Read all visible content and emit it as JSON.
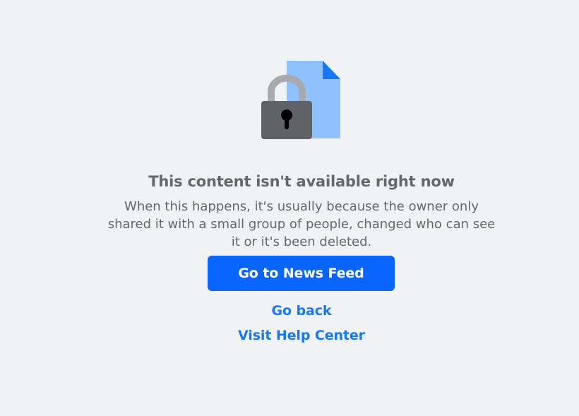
{
  "icon": {
    "name": "lock-document-icon",
    "colors": {
      "document": "#8fc1ff",
      "document_fold": "#1877f2",
      "shackle": "#a8aaaf",
      "lock_body": "#5f6368",
      "keyhole": "#000000"
    }
  },
  "message": {
    "title": "This content isn't available right now",
    "description": "When this happens, it's usually because the owner only shared it with a small group of people, changed who can see it or it's been deleted."
  },
  "actions": {
    "primary_label": "Go to News Feed",
    "go_back_label": "Go back",
    "help_center_label": "Visit Help Center"
  },
  "colors": {
    "background": "#f0f2f5",
    "text": "#65676b",
    "primary": "#0866ff",
    "link": "#1877f2"
  }
}
